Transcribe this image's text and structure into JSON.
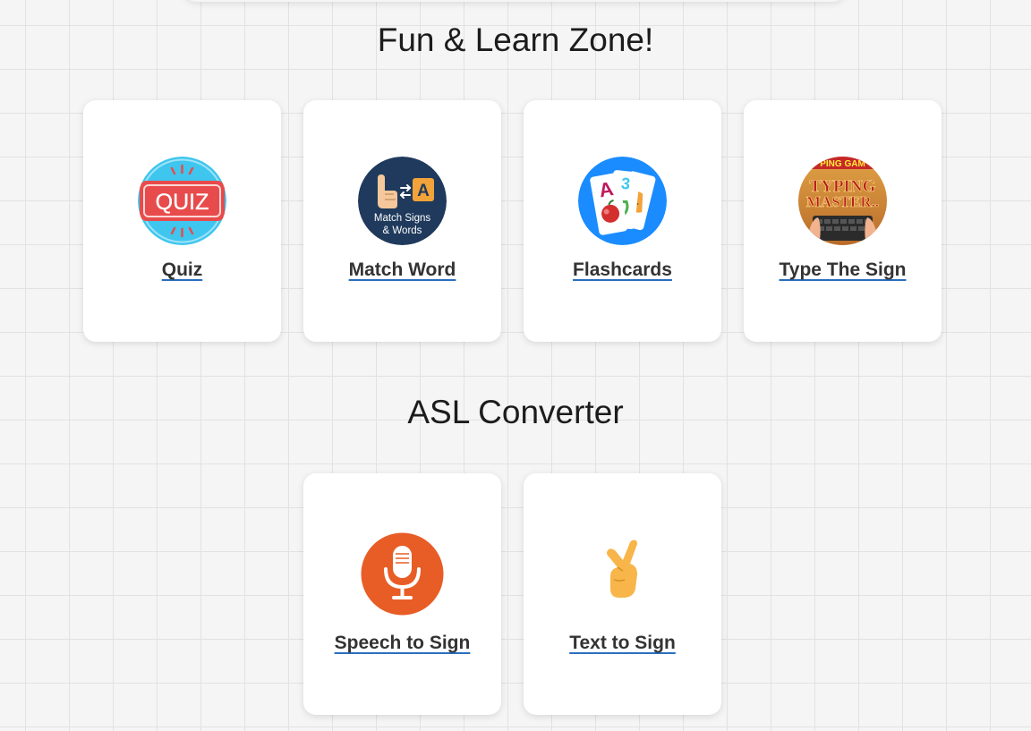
{
  "sections": {
    "fun": {
      "title": "Fun & Learn Zone!",
      "cards": [
        {
          "label": "Quiz",
          "icon": "quiz-icon",
          "icon_text": "QUIZ"
        },
        {
          "label": "Match Word",
          "icon": "match-signs-words-icon",
          "icon_text_1": "Match Signs",
          "icon_text_2": "& Words",
          "icon_letter": "A"
        },
        {
          "label": "Flashcards",
          "icon": "flashcards-icon"
        },
        {
          "label": "Type The Sign",
          "icon": "typing-master-icon",
          "icon_banner": "PING GAM",
          "icon_text_1": "TYPING",
          "icon_text_2": "MASTER.."
        }
      ]
    },
    "asl": {
      "title": "ASL Converter",
      "cards": [
        {
          "label": "Speech to Sign",
          "icon": "microphone-icon"
        },
        {
          "label": "Text to Sign",
          "icon": "pointing-hand-icon"
        }
      ]
    }
  },
  "colors": {
    "background": "#f5f5f5",
    "grid": "#e2e2e2",
    "card": "#ffffff",
    "label": "#333333",
    "link_underline": "#2a6fbd",
    "quiz_bg": "#3ec6ef",
    "quiz_red": "#e84b4b",
    "match_bg": "#1f3a5c",
    "flash_bg": "#1a8cff",
    "mic_bg": "#e85d26",
    "hand": "#f7b54a"
  }
}
